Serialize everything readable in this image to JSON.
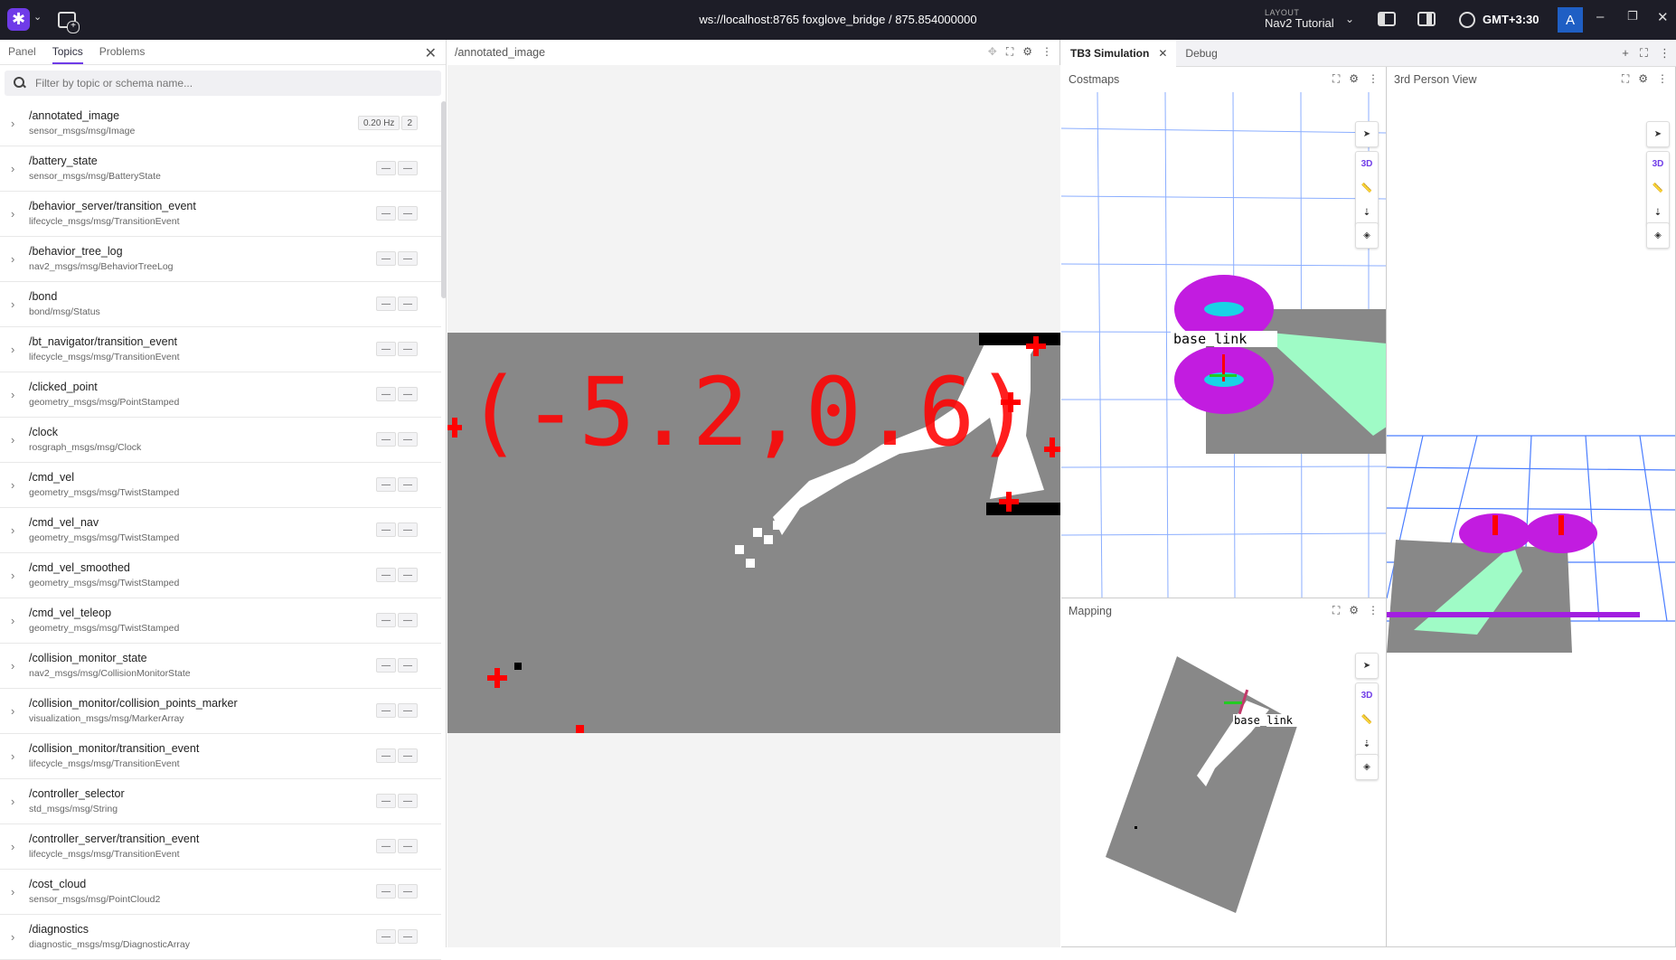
{
  "topbar": {
    "connection": "ws://localhost:8765 foxglove_bridge / 875.854000000",
    "layout_caption": "LAYOUT",
    "layout_name": "Nav2 Tutorial",
    "timezone": "GMT+3:30",
    "avatar_letter": "A"
  },
  "left_panel": {
    "tabs": [
      "Panel",
      "Topics",
      "Problems"
    ],
    "active_tab": "Topics",
    "filter_placeholder": "Filter by topic or schema name...",
    "topics": [
      {
        "name": "/annotated_image",
        "schema": "sensor_msgs/msg/Image",
        "hz": "0.20 Hz",
        "count": "2"
      },
      {
        "name": "/battery_state",
        "schema": "sensor_msgs/msg/BatteryState",
        "hz": "—",
        "count": "—"
      },
      {
        "name": "/behavior_server/transition_event",
        "schema": "lifecycle_msgs/msg/TransitionEvent",
        "hz": "—",
        "count": "—"
      },
      {
        "name": "/behavior_tree_log",
        "schema": "nav2_msgs/msg/BehaviorTreeLog",
        "hz": "—",
        "count": "—"
      },
      {
        "name": "/bond",
        "schema": "bond/msg/Status",
        "hz": "—",
        "count": "—"
      },
      {
        "name": "/bt_navigator/transition_event",
        "schema": "lifecycle_msgs/msg/TransitionEvent",
        "hz": "—",
        "count": "—"
      },
      {
        "name": "/clicked_point",
        "schema": "geometry_msgs/msg/PointStamped",
        "hz": "—",
        "count": "—"
      },
      {
        "name": "/clock",
        "schema": "rosgraph_msgs/msg/Clock",
        "hz": "—",
        "count": "—"
      },
      {
        "name": "/cmd_vel",
        "schema": "geometry_msgs/msg/TwistStamped",
        "hz": "—",
        "count": "—"
      },
      {
        "name": "/cmd_vel_nav",
        "schema": "geometry_msgs/msg/TwistStamped",
        "hz": "—",
        "count": "—"
      },
      {
        "name": "/cmd_vel_smoothed",
        "schema": "geometry_msgs/msg/TwistStamped",
        "hz": "—",
        "count": "—"
      },
      {
        "name": "/cmd_vel_teleop",
        "schema": "geometry_msgs/msg/TwistStamped",
        "hz": "—",
        "count": "—"
      },
      {
        "name": "/collision_monitor_state",
        "schema": "nav2_msgs/msg/CollisionMonitorState",
        "hz": "—",
        "count": "—"
      },
      {
        "name": "/collision_monitor/collision_points_marker",
        "schema": "visualization_msgs/msg/MarkerArray",
        "hz": "—",
        "count": "—"
      },
      {
        "name": "/collision_monitor/transition_event",
        "schema": "lifecycle_msgs/msg/TransitionEvent",
        "hz": "—",
        "count": "—"
      },
      {
        "name": "/controller_selector",
        "schema": "std_msgs/msg/String",
        "hz": "—",
        "count": "—"
      },
      {
        "name": "/controller_server/transition_event",
        "schema": "lifecycle_msgs/msg/TransitionEvent",
        "hz": "—",
        "count": "—"
      },
      {
        "name": "/cost_cloud",
        "schema": "sensor_msgs/msg/PointCloud2",
        "hz": "—",
        "count": "—"
      },
      {
        "name": "/diagnostics",
        "schema": "diagnostic_msgs/msg/DiagnosticArray",
        "hz": "—",
        "count": "—"
      }
    ]
  },
  "image_panel": {
    "title": "/annotated_image",
    "overlay_text": "(-5.2,0.6)"
  },
  "simulation": {
    "tabs": [
      "TB3 Simulation",
      "Debug"
    ],
    "active_tab": "TB3 Simulation",
    "panels": {
      "costmaps": "Costmaps",
      "third_person": "3rd Person View",
      "mapping": "Mapping"
    },
    "frame_label": "base_link",
    "tool_3d_label": "3D"
  },
  "colors": {
    "topbar_bg": "#1d1d27",
    "accent": "#6f3be8",
    "avatar_bg": "#1f5fc4",
    "map_gray": "#888888",
    "annotation_red": "#ff0000",
    "grid_blue": "#4a7dff",
    "scan_green": "#9ffbc6",
    "costmap_magenta": "#d41fe8"
  },
  "icons": [
    "foxglove-logo-icon",
    "add-panel-icon",
    "left-sidebar-icon",
    "right-sidebar-icon",
    "globe-icon",
    "search-icon",
    "close-icon",
    "chevron-right-icon",
    "fullscreen-icon",
    "gear-icon",
    "more-icon",
    "select-tool-icon",
    "ruler-icon",
    "publish-point-icon",
    "camera-center-icon"
  ]
}
